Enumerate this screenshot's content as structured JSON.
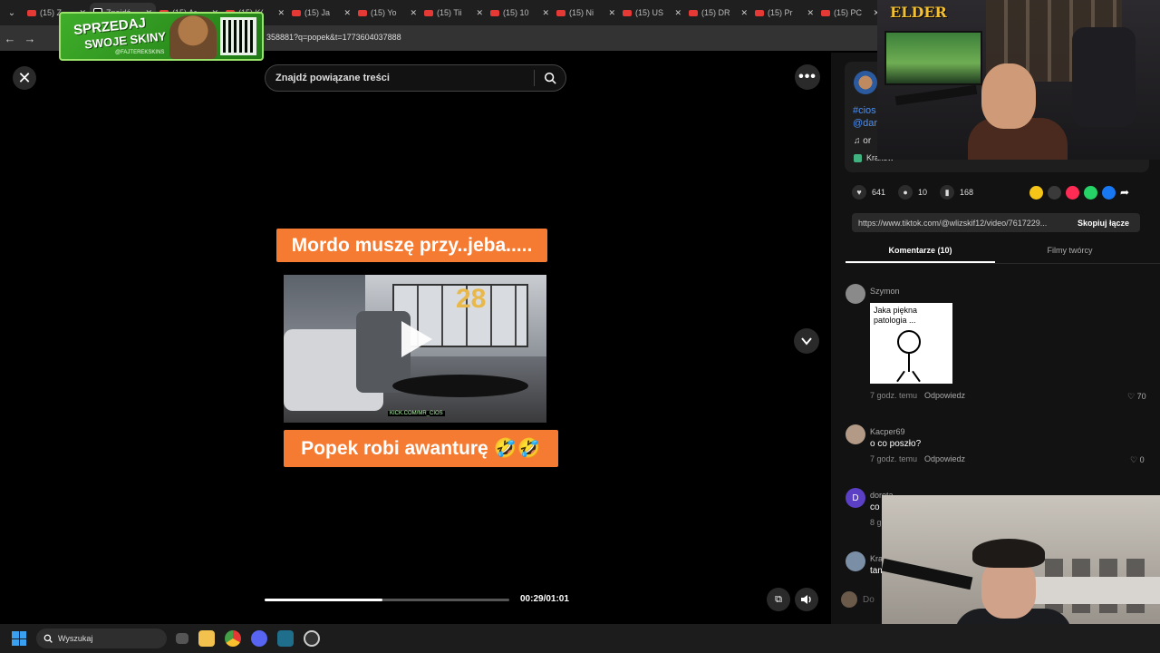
{
  "browser": {
    "tabs": [
      {
        "label": "(15) Z",
        "kind": "yt"
      },
      {
        "label": "Znajdź",
        "kind": "tt",
        "active": true
      },
      {
        "label": "(15) Ar",
        "kind": "yt"
      },
      {
        "label": "(15) K(",
        "kind": "yt"
      },
      {
        "label": "(15) Ja",
        "kind": "yt"
      },
      {
        "label": "(15) Yo",
        "kind": "yt"
      },
      {
        "label": "(15) Tii",
        "kind": "yt"
      },
      {
        "label": "(15) 10",
        "kind": "yt"
      },
      {
        "label": "(15) Ni",
        "kind": "yt"
      },
      {
        "label": "(15) US",
        "kind": "yt"
      },
      {
        "label": "(15) DR",
        "kind": "yt"
      },
      {
        "label": "(15) Pr",
        "kind": "yt"
      },
      {
        "label": "(15) PC",
        "kind": "yt"
      }
    ],
    "url_visible": "358881?q=popek&t=1773604037888"
  },
  "sponsor": {
    "line1": "SPRZEDAJ",
    "line2": "SWOJE SKINY",
    "handle": "@FAJTEREKSKINS"
  },
  "player": {
    "search_placeholder": "Znajdź powiązane treści",
    "caption_top": "Mordo muszę przy..jeba.....",
    "caption_bottom": "Popek robi awanturę 🤣🤣",
    "balloon_text": "28",
    "watermark": "KICK.COM/MR_CIOS",
    "progress": 0.48,
    "time": "00:29/01:01"
  },
  "details": {
    "hashtag_line1": "#cios",
    "hashtag_line2": "@dar",
    "music": "or",
    "location": "Kraków",
    "likes": "641",
    "comments": "10",
    "saves": "168",
    "share_link": "https://www.tiktok.com/@wlizskif12/video/7617229...",
    "copy_label": "Skopiuj łącze",
    "share_colors": [
      "#f5c518",
      "#3a3a3a",
      "#fe2c55",
      "#25d366",
      "#1877f2"
    ]
  },
  "tabs": {
    "comments_tab": "Komentarze (10)",
    "creator_tab": "Filmy twórcy"
  },
  "comments": [
    {
      "name": "Szymon",
      "sticker_text": "Jaka piękna patologia ...",
      "time": "7 godz. temu",
      "reply": "Odpowiedz",
      "likes": "70"
    },
    {
      "name": "Kacper69",
      "text": "o co poszło?",
      "time": "7 godz. temu",
      "reply": "Odpowiedz",
      "likes": "0"
    },
    {
      "name": "dorota...",
      "initial": "D",
      "text": "co",
      "time": "8 g"
    },
    {
      "name": "Kra",
      "text": "tam"
    }
  ],
  "comment_input": {
    "placeholder": "Do"
  },
  "overlay": {
    "streamer_logo": "ELDER"
  },
  "taskbar": {
    "search_label": "Wyszukaj"
  }
}
